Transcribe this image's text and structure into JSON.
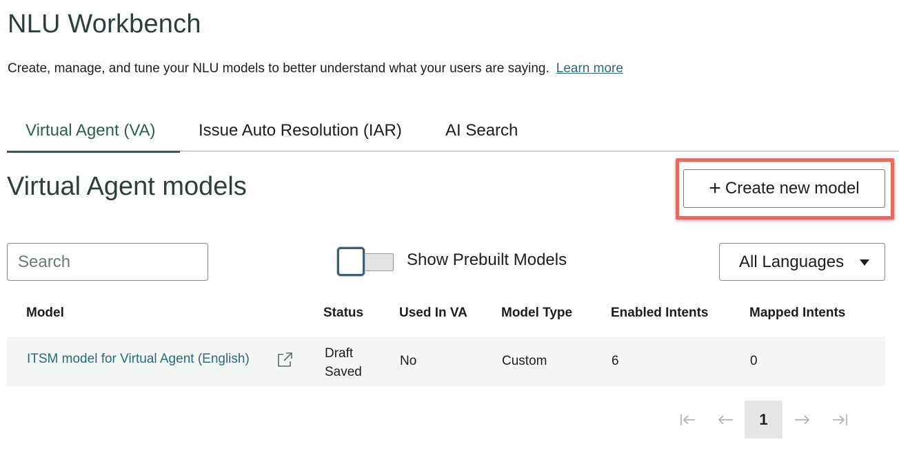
{
  "header": {
    "title": "NLU Workbench",
    "subtitle": "Create, manage, and tune your NLU models to better understand what your users are saying.",
    "learn_more": "Learn more"
  },
  "tabs": [
    {
      "label": "Virtual Agent (VA)",
      "active": true
    },
    {
      "label": "Issue Auto Resolution (IAR)",
      "active": false
    },
    {
      "label": "AI Search",
      "active": false
    }
  ],
  "section": {
    "title": "Virtual Agent models",
    "create_button": "Create new model",
    "highlight_color": "#e76a5d"
  },
  "filters": {
    "search_placeholder": "Search",
    "toggle_label": "Show Prebuilt Models",
    "toggle_on": false,
    "language": "All Languages"
  },
  "table": {
    "columns": [
      "Model",
      "Status",
      "Used In VA",
      "Model Type",
      "Enabled Intents",
      "Mapped Intents"
    ],
    "rows": [
      {
        "model": "ITSM model for Virtual Agent (English)",
        "status": "Draft Saved",
        "used_in_va": "No",
        "model_type": "Custom",
        "enabled_intents": "6",
        "mapped_intents": "0"
      }
    ]
  },
  "pagination": {
    "current_page": "1"
  },
  "colors": {
    "accent": "#2d5f4c",
    "link": "#2a6a78",
    "heading": "#2e3d3d"
  }
}
